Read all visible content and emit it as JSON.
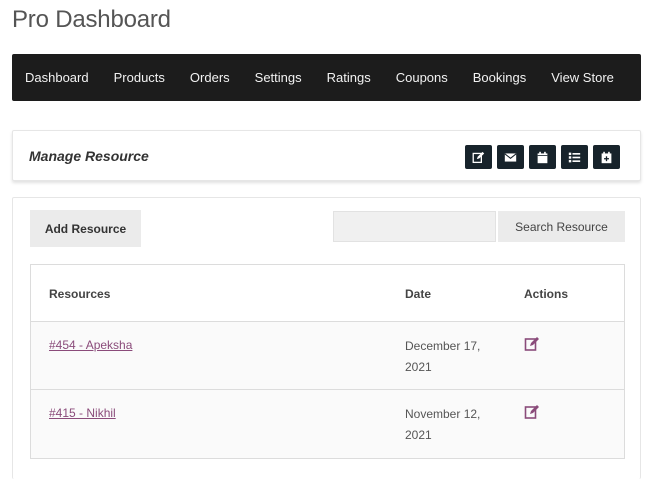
{
  "page": {
    "title": "Pro Dashboard"
  },
  "nav": {
    "items": [
      {
        "label": "Dashboard"
      },
      {
        "label": "Products"
      },
      {
        "label": "Orders"
      },
      {
        "label": "Settings"
      },
      {
        "label": "Ratings"
      },
      {
        "label": "Coupons"
      },
      {
        "label": "Bookings"
      },
      {
        "label": "View Store"
      }
    ]
  },
  "header": {
    "title": "Manage Resource",
    "icons": [
      "edit-icon",
      "envelope-icon",
      "calendar-icon",
      "list-icon",
      "calendar-plus-icon"
    ]
  },
  "toolbar": {
    "add_label": "Add Resource",
    "search_value": "",
    "search_label": "Search Resource"
  },
  "table": {
    "headers": {
      "resources": "Resources",
      "date": "Date",
      "actions": "Actions"
    },
    "rows": [
      {
        "resource": "#454 - Apeksha",
        "date": "December 17, 2021",
        "action_icon": "edit-icon"
      },
      {
        "resource": "#415 - Nikhil",
        "date": "November 12, 2021",
        "action_icon": "edit-icon"
      }
    ]
  },
  "colors": {
    "navbar_bg": "#1c1c1c",
    "icon_button_bg": "#17232b",
    "link": "#8a4b7a",
    "button_bg": "#ebebeb"
  }
}
